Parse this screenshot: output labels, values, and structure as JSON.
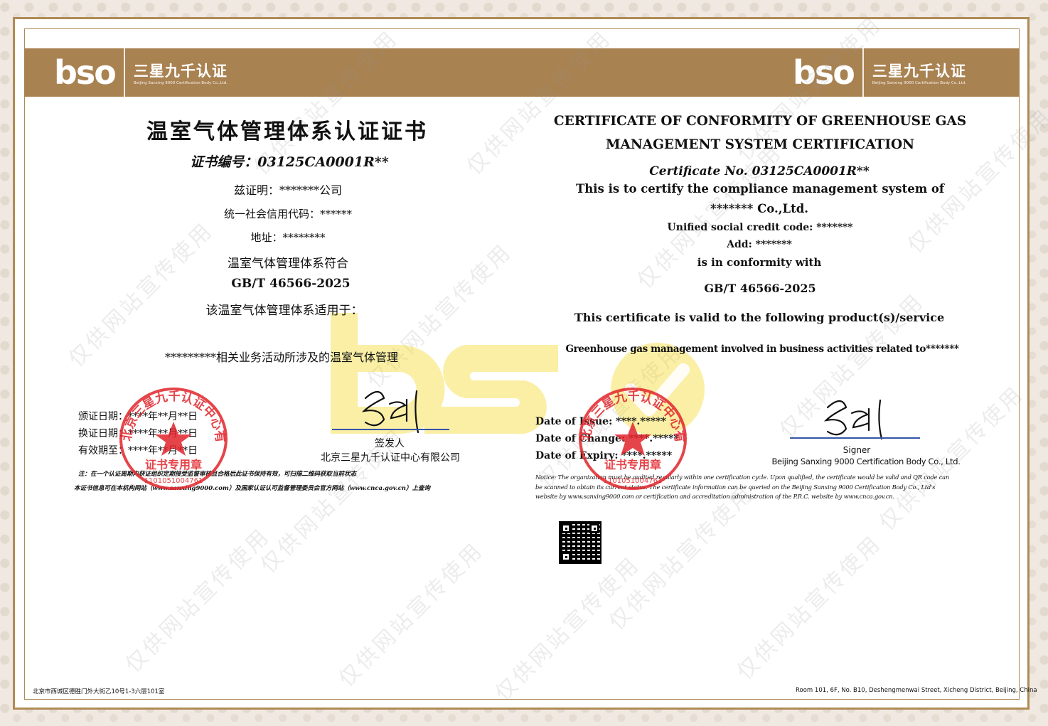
{
  "brand": {
    "logo": "bso",
    "name_cn": "三星九千认证",
    "name_en": "Beijing Sanxing 9000 Certification Body Co.,Ltd.",
    "banner_color": "#a98252",
    "seal_color": "#e0242a"
  },
  "cn": {
    "title": "温室气体管理体系认证证书",
    "cert_no": "证书编号：03125CA0001R**",
    "certify": "兹证明：*******公司",
    "credit_code": "统一社会信用代码：******",
    "address": "地址：********",
    "conform": "温室气体管理体系符合",
    "standard": "GB/T 46566-2025",
    "applies": "该温室气体管理体系适用于：",
    "scope": "*********相关业务活动所涉及的温室气体管理",
    "issue_date": "颁证日期：****年**月**日",
    "change_date": "换证日期：****年**月**日",
    "expiry_date": "有效期至：****年**月**日",
    "signer_label": "签发人",
    "signer_org": "北京三星九千认证中心有限公司",
    "note1": "注：在一个认证周期内获证组织定期接受监督审核且合格后此证书保持有效，可扫描二维码获取当前状态",
    "note2": "本证书信息可在本机构网站（www.sanxing9000.com）及国家认证认可监督管理委员会官方网站（www.cnca.gov.cn）上查询",
    "address_footer": "北京市西城区德胜门外大街乙10号1-3六层101室"
  },
  "en": {
    "title1": "CERTIFICATE OF CONFORMITY OF GREENHOUSE GAS",
    "title2": "MANAGEMENT SYSTEM CERTIFICATION",
    "cert_no": "Certificate No. 03125CA0001R**",
    "certify1": "This is to certify the compliance management system of",
    "certify2": "******* Co.,Ltd.",
    "credit_code": "Unified social credit code: *******",
    "address": "Add: *******",
    "conform": "is in conformity with",
    "standard": "GB/T 46566-2025",
    "valid": "This certificate is valid to the following product(s)/service",
    "scope": "Greenhouse gas management involved in business activities related to*******",
    "issue_date": "Date of Issue: ****.*****",
    "change_date": "Date of Change: ****.*****",
    "expiry_date": "Date of Expiry: ****.*****",
    "signer_label": "Signer",
    "signer_org": "Beijing Sanxing 9000 Certification Body Co., Ltd.",
    "notice1": "Notice: The organization must be audited regularly within one certification cycle. Upon qualified, the certificate would be valid and QR code can",
    "notice2": "be scanned to obtain its current status. The certificate information can be queried on the Beijing Sanxing 9000 Certification Body Co., Ltd's",
    "notice3": "website by www.sanxing9000.com or certification and accreditation administration of the P.R.C. website by www.cnca.gov.cn.",
    "address_footer": "Room 101, 6F, No. B10, Deshengmenwai Street, Xicheng District, Beijing, China"
  },
  "seal": {
    "arc_text": "北京三星九千认证中心有限公司",
    "label": "证书专用章",
    "number": "1101051004761"
  },
  "watermark": {
    "text": "仅供网站宣传使用"
  }
}
